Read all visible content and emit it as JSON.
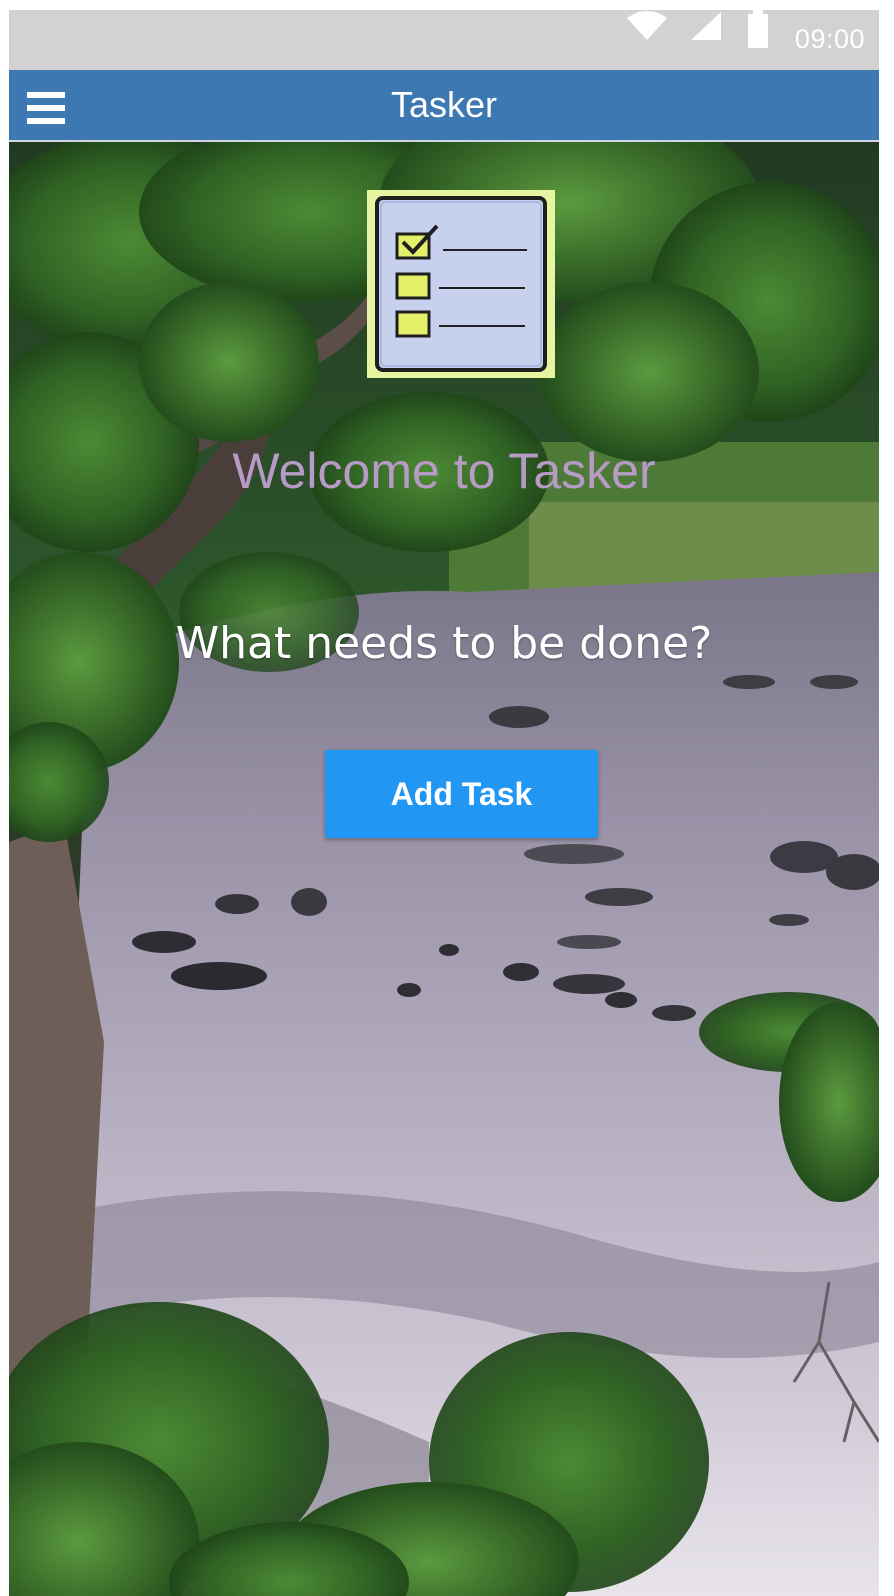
{
  "status_bar": {
    "time": "09:00",
    "icons": [
      "wifi-icon",
      "signal-icon",
      "battery-icon"
    ]
  },
  "app_bar": {
    "title": "Tasker",
    "menu_icon": "hamburger-menu-icon",
    "color": "#3e78b2"
  },
  "main": {
    "logo_icon": "checklist-icon",
    "welcome": "Welcome to Tasker",
    "prompt": "What needs to be done?",
    "add_task_label": "Add Task",
    "button_color": "#2196f3"
  }
}
